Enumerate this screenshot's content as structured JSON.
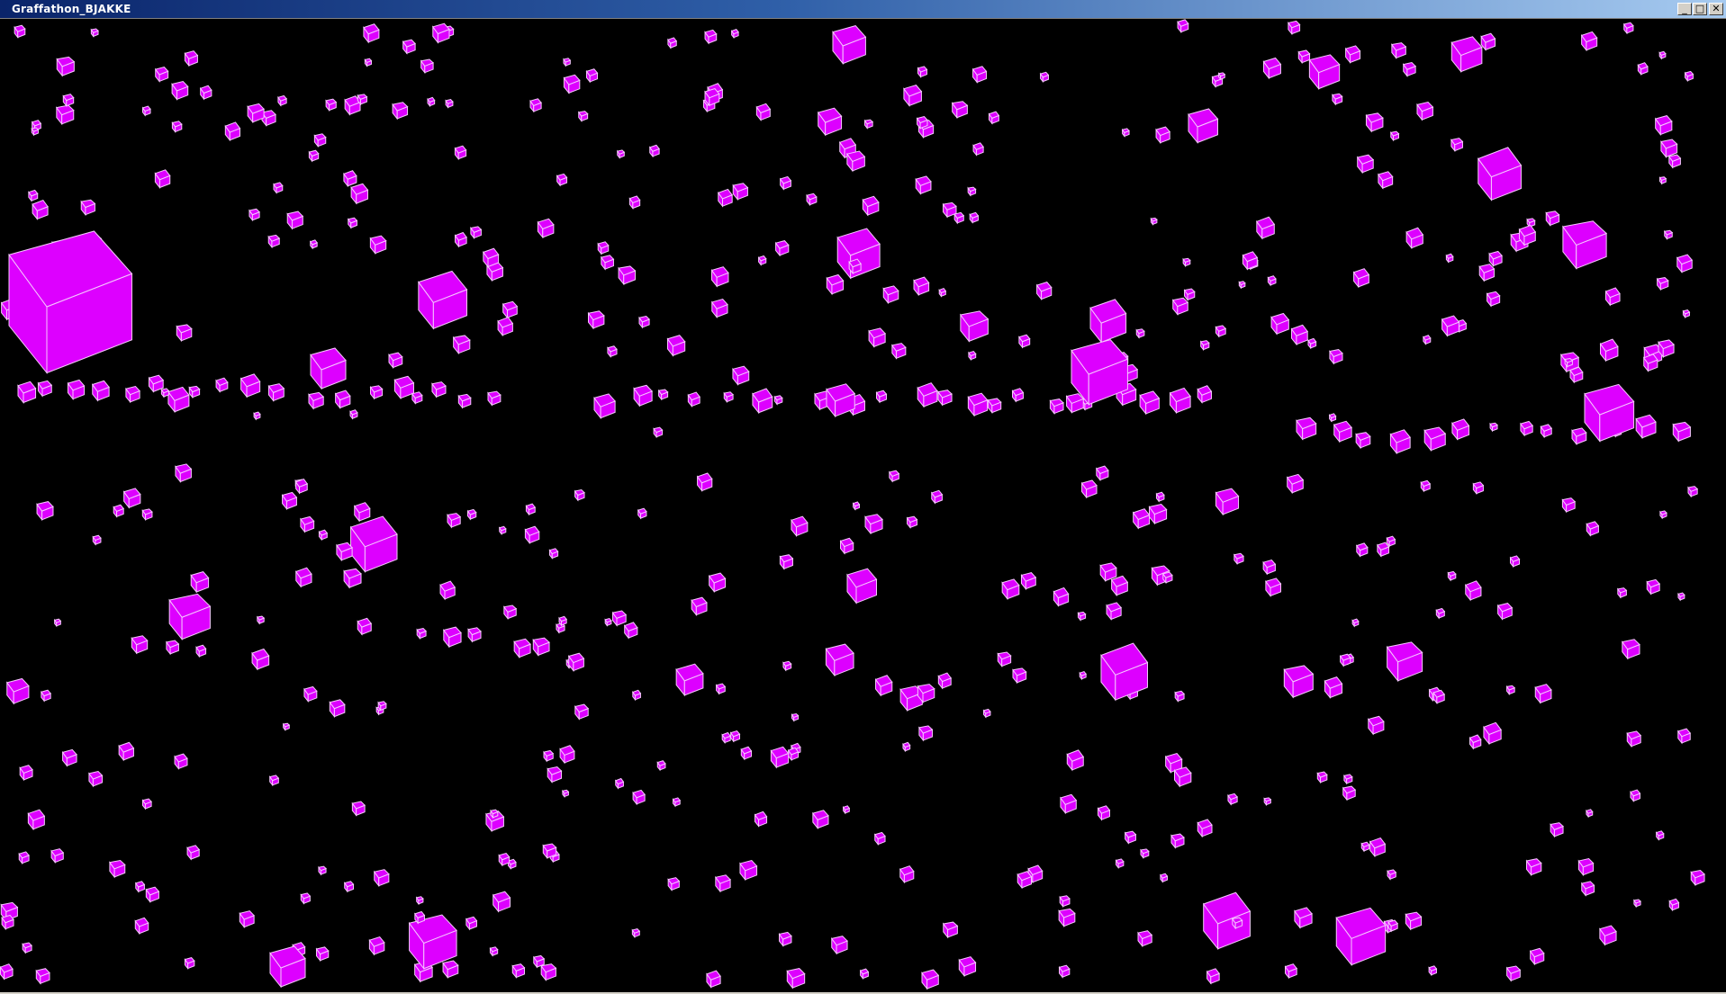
{
  "window": {
    "title": "Graffathon_BJAKKE",
    "buttons": {
      "minimize": "_",
      "maximize": "□",
      "close": "✕"
    }
  },
  "scene": {
    "background": "#000000",
    "cube_face_color": "#dd00ff",
    "cube_edge_color": "#f6c8ff"
  },
  "colors": {
    "titlebar_start": "#0a246a",
    "titlebar_end": "#a6caf0",
    "frame": "#d4d0c8"
  }
}
